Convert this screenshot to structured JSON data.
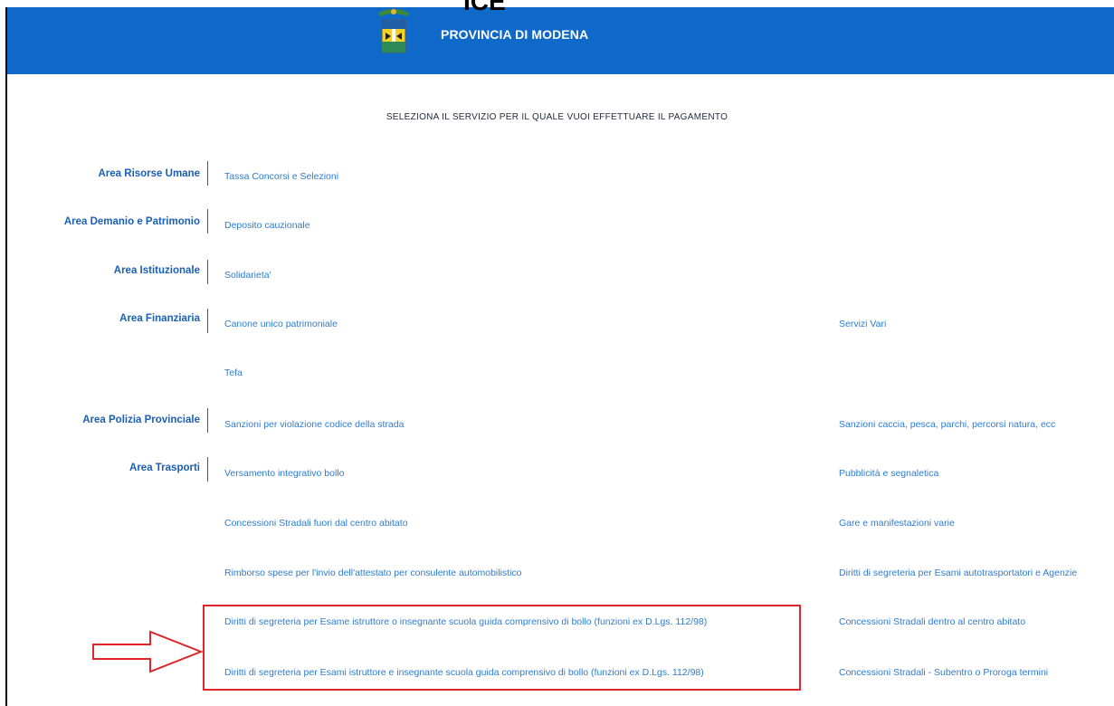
{
  "header": {
    "title": "PROVINCIA DI MODENA",
    "top_fragment": "ICE"
  },
  "intro": "SELEZIONA IL SERVIZIO PER IL QUALE VUOI EFFETTUARE IL PAGAMENTO",
  "areas": [
    {
      "label": "Area Risorse Umane",
      "services": [
        "Tassa Concorsi e Selezioni"
      ]
    },
    {
      "label": "Area Demanio e Patrimonio",
      "services": [
        "Deposito cauzionale"
      ]
    },
    {
      "label": "Area Istituzionale",
      "services": [
        "Solidarieta'"
      ]
    },
    {
      "label": "Area Finanziaria",
      "services": [
        "Canone unico patrimoniale",
        "Servizi Vari",
        "Tefa"
      ]
    },
    {
      "label": "Area Polizia Provinciale",
      "services": [
        "Sanzioni per violazione codice della strada",
        "Sanzioni caccia, pesca, parchi, percorsi natura, ecc"
      ]
    },
    {
      "label": "Area Trasporti",
      "services": [
        "Versamento integrativo bollo",
        "Pubblicità e segnaletica",
        "Concessioni Stradali fuori dal centro abitato",
        "Gare e manifestazioni varie",
        "Rimborso spese per l'invio dell'attestato per consulente automobilistico",
        "Diritti di segreteria per Esami autotrasportatori e Agenzie",
        "Diritti di segreteria per Esame istruttore o insegnante scuola guida comprensivo di bollo (funzioni ex D.Lgs. 112/98)",
        "Concessioni Stradali dentro al centro abitato",
        "Diritti di segreteria per Esami istruttore e insegnante scuola guida comprensivo di bollo (funzioni ex D.Lgs. 112/98)",
        "Concessioni Stradali - Subentro o Proroga termini"
      ]
    }
  ],
  "colors": {
    "header_bg": "#0f69c9",
    "area_label": "#1a5fb4",
    "link": "#2e7cd1",
    "annotation": "#e0262a"
  }
}
